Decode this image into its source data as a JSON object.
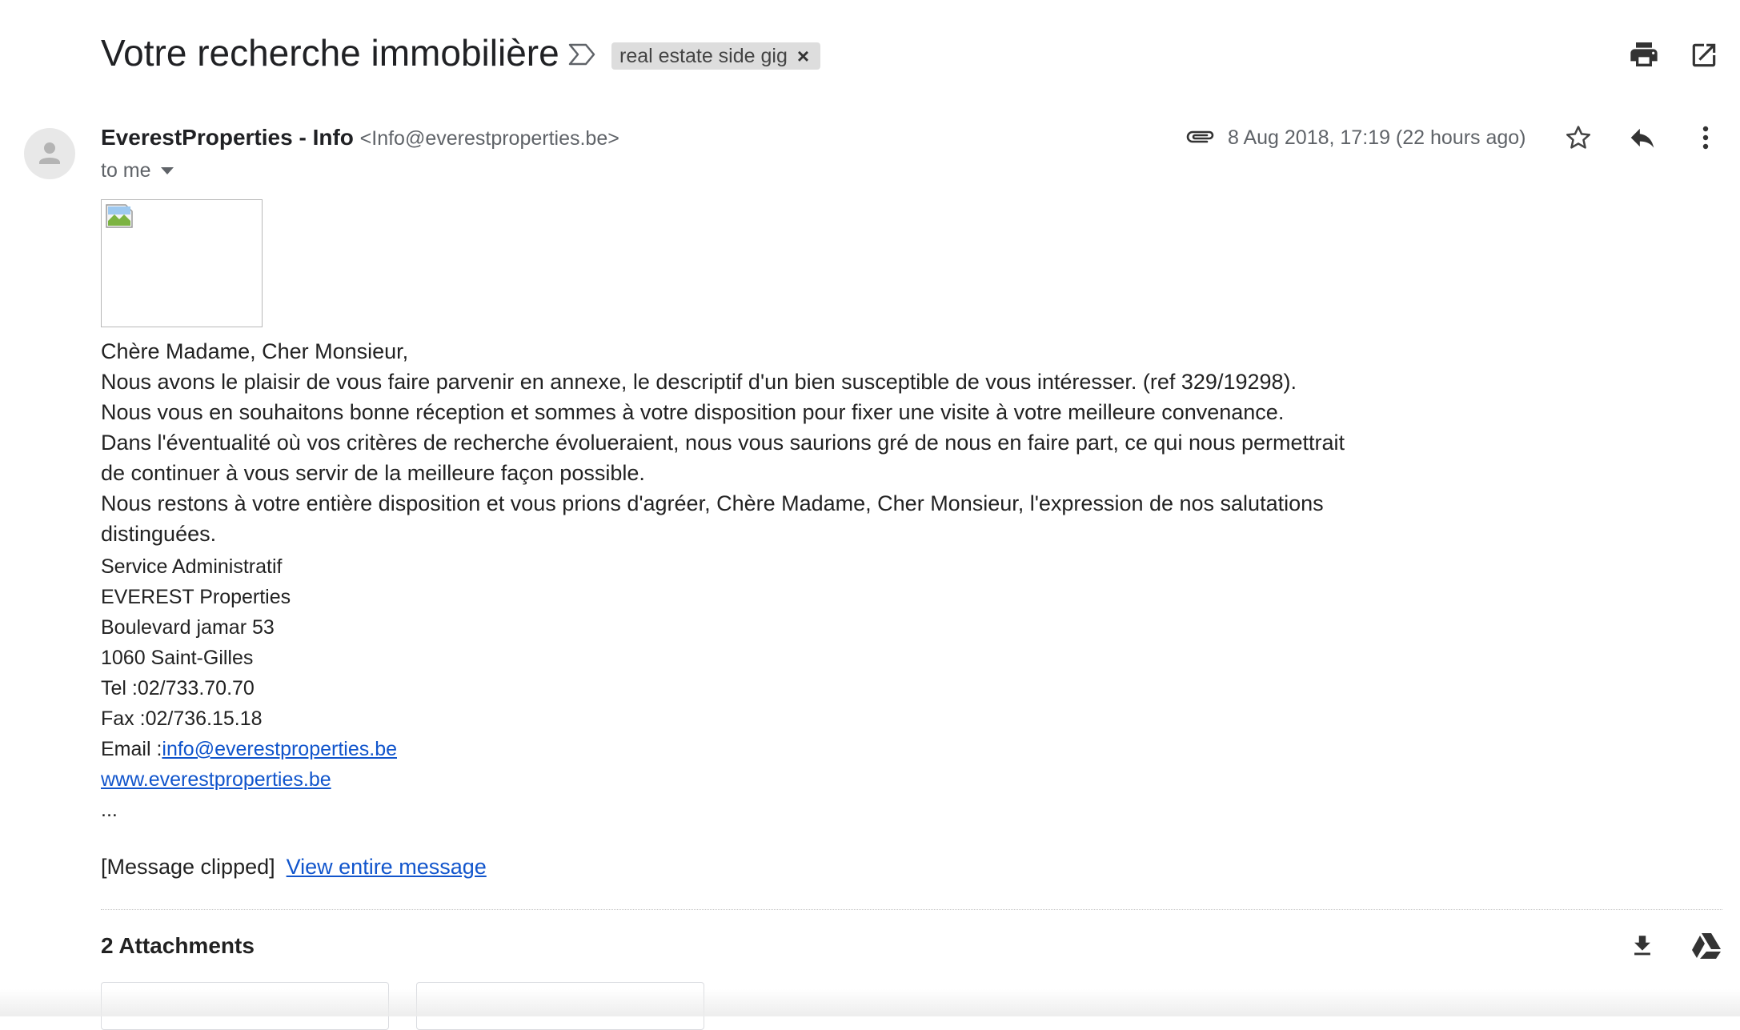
{
  "header": {
    "subject": "Votre recherche immobilière",
    "label": "real estate side gig",
    "label_close": "×",
    "icons": [
      "important-marker-icon",
      "print-icon",
      "open-in-new-window-icon"
    ]
  },
  "message": {
    "sender_name": "EverestProperties - Info",
    "sender_email": "<Info@everestproperties.be>",
    "recipient": "to me",
    "date": "8 Aug 2018, 17:19 (22 hours ago)",
    "icons": [
      "avatar-icon",
      "attachment-icon",
      "star-icon",
      "reply-icon",
      "more-options-icon"
    ]
  },
  "body": {
    "greeting": "Chère Madame, Cher Monsieur,",
    "lines": [
      "Nous avons le plaisir de vous faire parvenir en annexe, le descriptif d'un bien susceptible de vous intéresser. (ref 329/19298).",
      "Nous vous en souhaitons bonne réception et sommes à votre disposition pour fixer une visite à votre meilleure convenance.",
      "Dans l'éventualité où vos critères de recherche évolueraient, nous vous saurions gré de nous en faire part, ce qui nous permettrait de continuer à vous servir de la meilleure façon possible.",
      "Nous restons à votre entière disposition et vous prions d'agréer, Chère Madame, Cher Monsieur, l'expression de nos salutations distinguées."
    ]
  },
  "signature": {
    "department": "Service Administratif",
    "company": "EVEREST Properties",
    "street": "Boulevard jamar 53",
    "city": "1060 Saint-Gilles",
    "tel": "Tel :02/733.70.70",
    "fax": "Fax :02/736.15.18",
    "email_prefix": "Email :",
    "email_link": "info@everestproperties.be",
    "website": "www.everestproperties.be",
    "ellipsis": "..."
  },
  "clipped": {
    "notice": "[Message clipped]",
    "link": "View entire message"
  },
  "attachments": {
    "title": "2 Attachments",
    "icons": [
      "download-all-icon",
      "save-to-drive-icon"
    ]
  }
}
